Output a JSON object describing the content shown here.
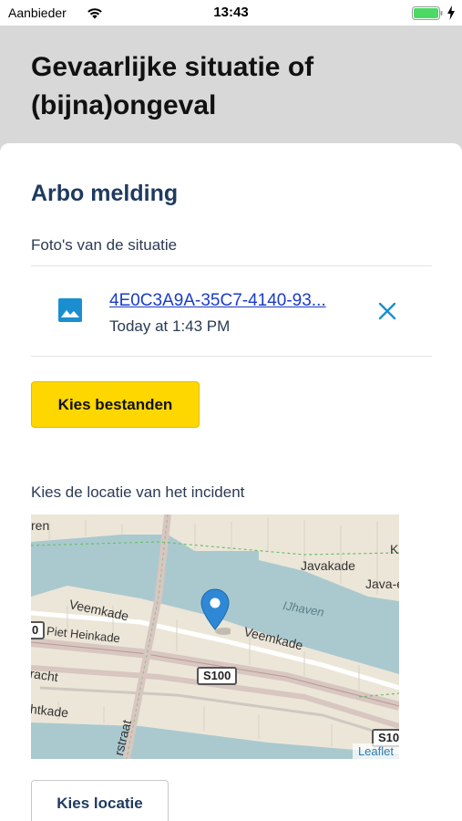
{
  "status_bar": {
    "carrier": "Aanbieder",
    "time": "13:43",
    "battery_color": "#4cd964"
  },
  "header": {
    "title": "Gevaarlijke situatie of (bijna)ongeval"
  },
  "form": {
    "section_title": "Arbo melding",
    "photos_label": "Foto's van de situatie",
    "file": {
      "name": "4E0C3A9A-35C7-4140-93...",
      "time": "Today at 1:43 PM",
      "icon": "image-icon",
      "remove_icon": "close-icon"
    },
    "choose_files_label": "Kies bestanden",
    "location_label": "Kies de locatie van het incident",
    "map": {
      "labels": {
        "edge_top_left": "ren",
        "javakade": "Javakade",
        "java_edge": "Java-e",
        "ijhaven": "IJhaven",
        "veemkade_left": "Veemkade",
        "veemkade_right": "Veemkade",
        "piet_heinkade": "Piet Heinkade",
        "racht": "racht",
        "htkade": "htkade",
        "straat": "rstraat",
        "edge_right_k": "K"
      },
      "road_shields": {
        "s100": "S100",
        "s10_edge": "S10",
        "left_edge": "0"
      },
      "attribution": "Leaflet",
      "water_color": "#aac9cf",
      "land_color": "#ece6d8",
      "marker_color": "#2e88d6"
    },
    "choose_location_label": "Kies locatie"
  }
}
